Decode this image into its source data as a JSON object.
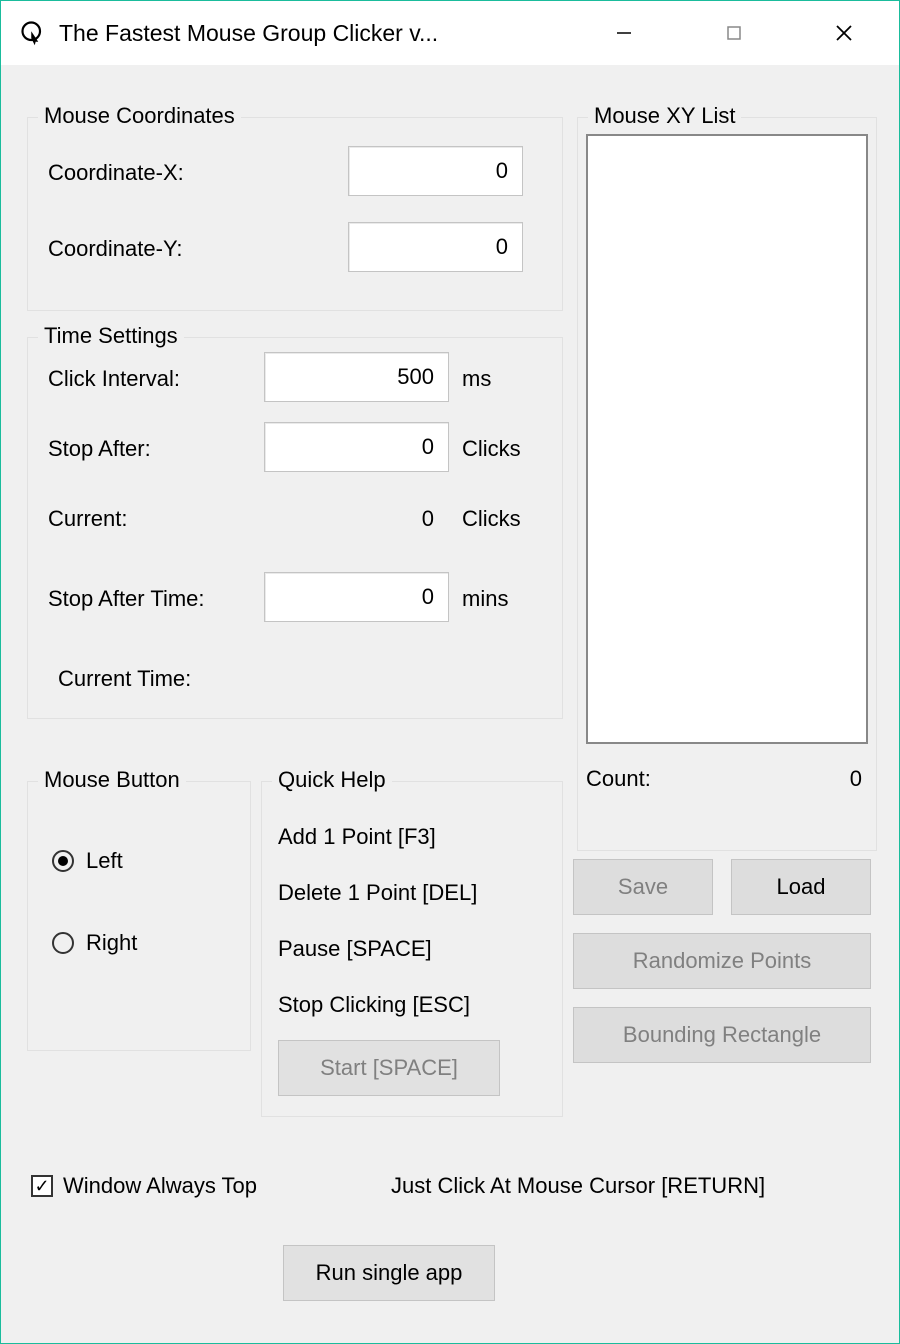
{
  "window": {
    "title": "The Fastest Mouse Group Clicker v..."
  },
  "coords": {
    "legend": "Mouse Coordinates",
    "x_label": "Coordinate-X:",
    "x_value": "0",
    "y_label": "Coordinate-Y:",
    "y_value": "0"
  },
  "time": {
    "legend": "Time Settings",
    "interval_label": "Click Interval:",
    "interval_value": "500",
    "interval_unit": "ms",
    "stop_after_label": "Stop After:",
    "stop_after_value": "0",
    "stop_after_unit": "Clicks",
    "current_label": "Current:",
    "current_value": "0",
    "current_unit": "Clicks",
    "stop_time_label": "Stop After Time:",
    "stop_time_value": "0",
    "stop_time_unit": "mins",
    "current_time_label": "Current Time:"
  },
  "mouse_button": {
    "legend": "Mouse Button",
    "left_label": "Left",
    "right_label": "Right",
    "selected": "left"
  },
  "quick_help": {
    "legend": "Quick Help",
    "line1": "Add 1 Point [F3]",
    "line2": "Delete 1 Point [DEL]",
    "line3": "Pause [SPACE]",
    "line4": "Stop Clicking [ESC]",
    "start_button": "Start [SPACE]"
  },
  "xy_list": {
    "legend": "Mouse XY List",
    "count_label": "Count:",
    "count_value": "0",
    "save_button": "Save",
    "load_button": "Load",
    "randomize_button": "Randomize Points",
    "bounding_button": "Bounding Rectangle"
  },
  "footer": {
    "always_top_label": "Window Always Top",
    "always_top_checked": true,
    "just_click_label": "Just Click At Mouse Cursor [RETURN]",
    "run_button": "Run single app"
  }
}
